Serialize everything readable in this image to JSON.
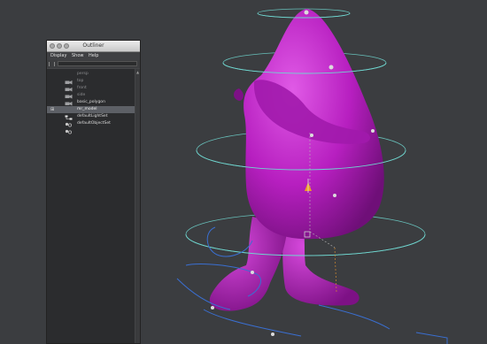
{
  "viewport": {
    "background": "#3b3d40",
    "model_color": "#b71fc0",
    "control_color": "#6fd6cf"
  },
  "outliner": {
    "title": "Outliner",
    "menus": [
      "Display",
      "Show",
      "Help"
    ],
    "items": [
      {
        "label": "persp",
        "icon": "camera-icon",
        "state": "dim"
      },
      {
        "label": "top",
        "icon": "camera-icon",
        "state": "dim"
      },
      {
        "label": "front",
        "icon": "camera-icon",
        "state": "dim"
      },
      {
        "label": "side",
        "icon": "camera-icon",
        "state": "dim"
      },
      {
        "label": "basic_polygon",
        "icon": "transform-icon",
        "state": "bright"
      },
      {
        "label": "mr_model",
        "icon": "hierarchy-icon",
        "state": "selected"
      },
      {
        "label": "defaultLightSet",
        "icon": "set-icon",
        "state": "bright"
      },
      {
        "label": "defaultObjectSet",
        "icon": "set-icon",
        "state": "bright"
      }
    ]
  }
}
